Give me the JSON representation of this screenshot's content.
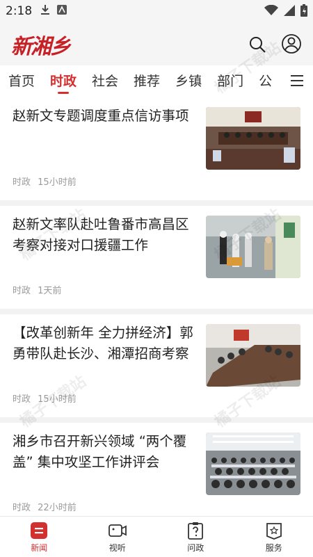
{
  "status_bar": {
    "time": "2:18"
  },
  "header": {
    "logo_text": "新湘乡"
  },
  "tabs": [
    {
      "label": "首页",
      "active": false
    },
    {
      "label": "时政",
      "active": true
    },
    {
      "label": "社会",
      "active": false
    },
    {
      "label": "推荐",
      "active": false
    },
    {
      "label": "乡镇",
      "active": false
    },
    {
      "label": "部门",
      "active": false
    },
    {
      "label": "公",
      "active": false
    }
  ],
  "articles": [
    {
      "title": "赵新文专题调度重点信访事项",
      "category": "时政",
      "time": "15小时前",
      "thumb": "meeting-room"
    },
    {
      "title": "赵新文率队赴吐鲁番市高昌区考察对接对口援疆工作",
      "category": "时政",
      "time": "1天前",
      "thumb": "factory-visit"
    },
    {
      "title": "【改革创新年 全力拼经济】郭勇带队赴长沙、湘潭招商考察",
      "category": "时政",
      "time": "15小时前",
      "thumb": "conference-table"
    },
    {
      "title": "湘乡市召开新兴领域 “两个覆盖” 集中攻坚工作讲评会",
      "category": "时政",
      "time": "22小时前",
      "thumb": "auditorium"
    }
  ],
  "bottom_nav": [
    {
      "label": "新闻",
      "icon": "news-icon",
      "active": true
    },
    {
      "label": "视听",
      "icon": "video-icon",
      "active": false
    },
    {
      "label": "问政",
      "icon": "question-icon",
      "active": false
    },
    {
      "label": "服务",
      "icon": "service-icon",
      "active": false
    }
  ],
  "watermark": "橘子下载站",
  "colors": {
    "accent": "#d32f2f",
    "meta": "#9a9a9a",
    "background": "#f2f2f2"
  }
}
